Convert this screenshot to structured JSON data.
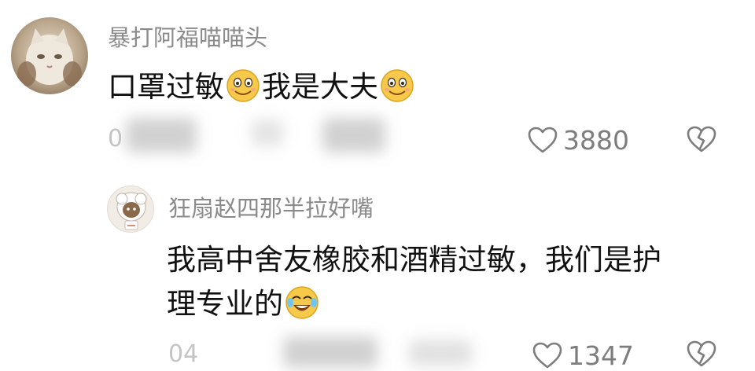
{
  "comment": {
    "username": "暴打阿福喵喵头",
    "text_part1": "口罩过敏",
    "text_part2": "我是大夫",
    "emoji_1": "smile-emoji",
    "emoji_2": "smile-emoji",
    "meta_partial": "0",
    "likes": "3880",
    "like_icon": "heart-outline-icon",
    "dislike_icon": "broken-heart-icon"
  },
  "reply": {
    "username": "狂扇赵四那半拉好嘴",
    "text_line1": "我高中舍友橡胶和酒精过敏，我们是护",
    "text_line2": "理专业的",
    "emoji": "laugh-cry-emoji",
    "meta_partial": "04",
    "likes": "1347",
    "like_icon": "heart-outline-icon",
    "dislike_icon": "broken-heart-icon"
  },
  "colors": {
    "username": "#8a8a8a",
    "text": "#111111",
    "meta": "#7d7d7d",
    "emoji_yellow": "#f7c94a"
  }
}
